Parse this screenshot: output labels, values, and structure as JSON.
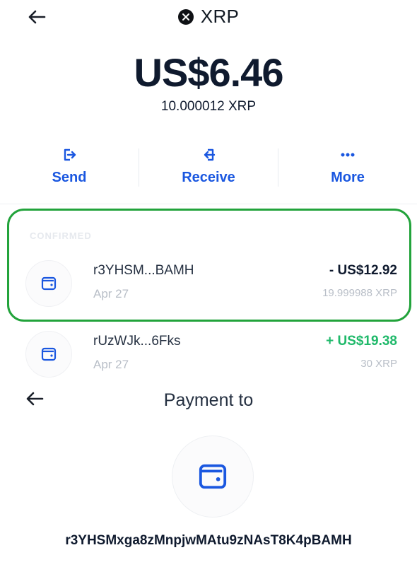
{
  "header": {
    "title": "XRP"
  },
  "balance": {
    "fiat": "US$6.46",
    "crypto": "10.000012 XRP"
  },
  "actions": [
    {
      "label": "Send"
    },
    {
      "label": "Receive"
    },
    {
      "label": "More"
    }
  ],
  "transactions": {
    "section_label": "CONFIRMED",
    "items": [
      {
        "address": "r3YHSM...BAMH",
        "date": "Apr 27",
        "fiat": "- US$12.92",
        "crypto": "19.999988 XRP",
        "direction": "out"
      },
      {
        "address": "rUzWJk...6Fks",
        "date": "Apr 27",
        "fiat": "+ US$19.38",
        "crypto": "30 XRP",
        "direction": "in"
      }
    ]
  },
  "payment": {
    "title": "Payment to",
    "address": "r3YHSMxga8zMnpjwMAtu9zNAsT8K4pBAMH"
  },
  "colors": {
    "accent": "#1a57e0",
    "positive": "#1fb96a",
    "highlight": "#22a33b"
  }
}
